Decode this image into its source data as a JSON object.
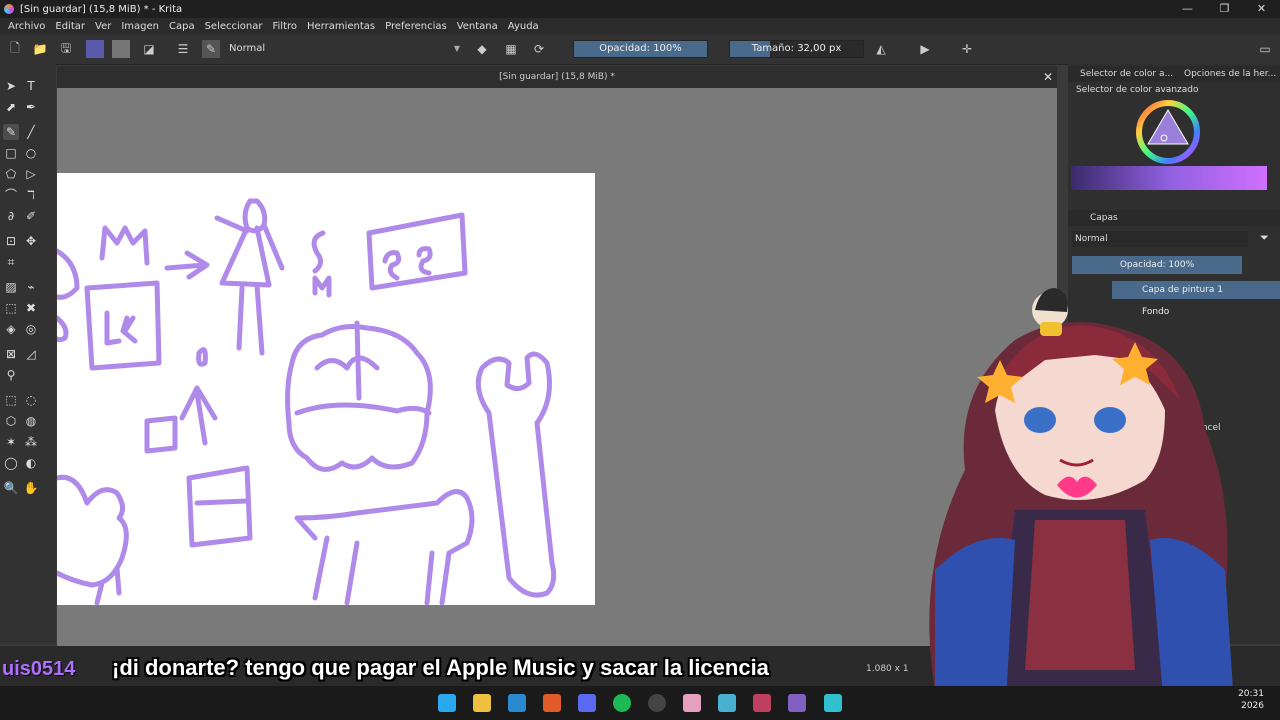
{
  "window": {
    "title": "[Sin guardar]  (15,8 MiB) * - Krita",
    "controls": [
      "—",
      "❐",
      "✕"
    ]
  },
  "menu": [
    "Archivo",
    "Editar",
    "Ver",
    "Imagen",
    "Capa",
    "Seleccionar",
    "Filtro",
    "Herramientas",
    "Preferencias",
    "Ventana",
    "Ayuda"
  ],
  "toolbar": {
    "blend_mode": "Normal",
    "opacity_label": "Opacidad: 100%",
    "opacity": 1.0,
    "size_label": "Tamaño: 32,00 px",
    "size_fraction": 0.3
  },
  "document": {
    "tab_title": "[Sin guardar]  (15,8 MiB) *"
  },
  "dockers": {
    "tab_color": "Selector de color a...",
    "tab_options": "Opciones de la her...",
    "advanced_color": "Selector de color avanzado",
    "layers_title": "Capas",
    "layers_blend": "Normal",
    "layers_opacity": "Opacidad:  100%",
    "layers": [
      "Capa de pintura 1",
      "Fondo"
    ],
    "brushes_title": "Pinceles de pincel"
  },
  "status": {
    "zoom": "1.080 x 1"
  },
  "stream": {
    "username": "uis0514",
    "subtitle": "¡di donarte? tengo que pagar el Apple Music y sacar la licencia"
  },
  "clock": {
    "time": "20:31",
    "year": "2026"
  },
  "colors": {
    "accent": "#4a6a8c",
    "stroke": "#b08ae8"
  }
}
